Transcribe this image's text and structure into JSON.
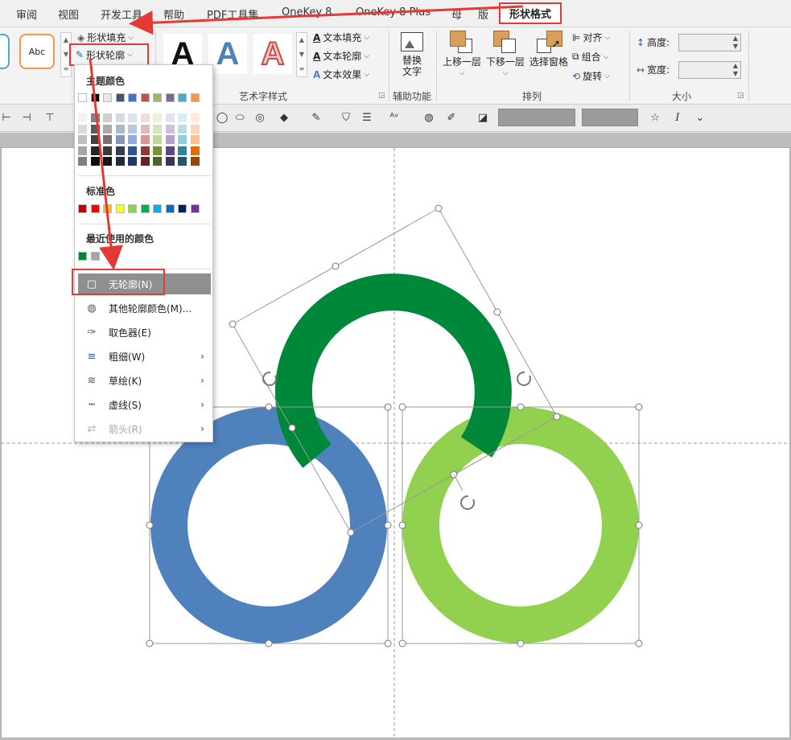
{
  "tabs": [
    "审阅",
    "视图",
    "开发工具",
    "帮助",
    "PDF工具集",
    "OneKey 8",
    "OneKey 8 Plus",
    "母",
    "版"
  ],
  "active_tab": "形状格式",
  "ribbon": {
    "shape_style_sample": "Abc",
    "shape_fill": "形状填充",
    "shape_outline": "形状轮廓",
    "wordart_label": "艺术字样式",
    "wordart_letter": "A",
    "text_fill": "文本填充",
    "text_outline": "文本轮廓",
    "text_effect": "文本效果",
    "alt_text_line1": "替换",
    "alt_text_line2": "文字",
    "accessibility_label": "辅助功能",
    "bring_forward": "上移一层",
    "send_backward": "下移一层",
    "selection_pane": "选择窗格",
    "align": "对齐",
    "group": "组合",
    "rotate": "旋转",
    "arrange_label": "排列",
    "height_label": "高度:",
    "width_label": "宽度:",
    "size_label": "大小"
  },
  "menu": {
    "theme_colors_header": "主题颜色",
    "standard_colors_header": "标准色",
    "recent_colors_header": "最近使用的颜色",
    "items": [
      {
        "label": "无轮廓(N)",
        "icon": "no-outline-icon"
      },
      {
        "label": "其他轮廓颜色(M)...",
        "icon": "palette-icon"
      },
      {
        "label": "取色器(E)",
        "icon": "eyedropper-icon"
      },
      {
        "label": "粗细(W)",
        "icon": "line-weight-icon"
      },
      {
        "label": "草绘(K)",
        "icon": "sketch-icon"
      },
      {
        "label": "虚线(S)",
        "icon": "dashes-icon"
      },
      {
        "label": "箭头(R)",
        "icon": "arrows-icon"
      }
    ],
    "theme_top": [
      "#ffffff",
      "#000000",
      "#e7e6e6",
      "#44546a",
      "#4472c4",
      "#c0504d",
      "#9bbb59",
      "#8064a2",
      "#4bacc6",
      "#f79646"
    ],
    "theme_shades": [
      [
        "#f2f2f2",
        "#d9d9d9",
        "#bfbfbf",
        "#a6a6a6",
        "#808080"
      ],
      [
        "#808080",
        "#595959",
        "#404040",
        "#262626",
        "#0d0d0d"
      ],
      [
        "#d0cece",
        "#aeaaaa",
        "#757171",
        "#3a3838",
        "#171616"
      ],
      [
        "#d6dce4",
        "#adb9ca",
        "#8496b0",
        "#333f4f",
        "#222a35"
      ],
      [
        "#dae3f3",
        "#b4c7e7",
        "#8faadc",
        "#2f5597",
        "#1f3864"
      ],
      [
        "#f2dcdb",
        "#e6b9b8",
        "#d99694",
        "#953734",
        "#632523"
      ],
      [
        "#ebf1dd",
        "#d7e3bc",
        "#c3d69b",
        "#76923c",
        "#4f6128"
      ],
      [
        "#e5e0ec",
        "#ccc1d9",
        "#b2a2c7",
        "#5f497a",
        "#3f3151"
      ],
      [
        "#dbeef3",
        "#b7dde8",
        "#92cddc",
        "#31859b",
        "#205867"
      ],
      [
        "#fdeada",
        "#fbd5b5",
        "#fac08f",
        "#e36c09",
        "#974806"
      ]
    ],
    "standard": [
      "#c00000",
      "#ff0000",
      "#ffc000",
      "#ffff00",
      "#92d050",
      "#00b050",
      "#00b0f0",
      "#0070c0",
      "#002060",
      "#7030a0"
    ],
    "recent": [
      "#00883a",
      "#a5a5a5"
    ]
  },
  "shapes": {
    "green_ring": "#00883a",
    "blue_ring": "#4f81bd",
    "light_green_ring": "#92d050"
  }
}
